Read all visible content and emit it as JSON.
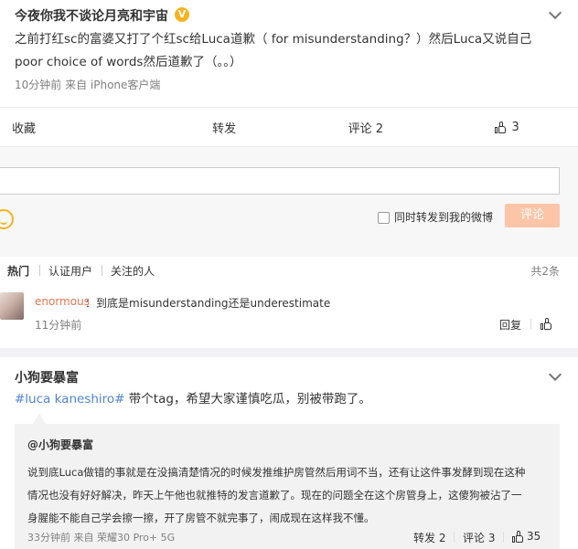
{
  "post1": {
    "author": "今夜你我不谈论月亮和宇宙",
    "verified_badge": "V",
    "line1": "之前打红sc的富婆又打了个红sc给Luca道歉（ for misunderstanding？）然后Luca又说自己",
    "line2": "poor choice of words然后道歉了（。。）",
    "meta": "10分钟前  来自 iPhone客户端"
  },
  "actions": {
    "favorite": "收藏",
    "repost": "转发",
    "comment": "评论 2",
    "like_count": "3"
  },
  "comment_box": {
    "also_repost_label": "同时转发到我的微博",
    "submit_label": "评论"
  },
  "comment_tabs": {
    "hot": "热门",
    "verified": "认证用户",
    "following": "关注的人",
    "total": "共2条"
  },
  "comments": [
    {
      "user": "enormous",
      "text": "：到底是misunderstanding还是underestimate",
      "time": "11分钟前",
      "reply": "回复"
    }
  ],
  "post2": {
    "author": "小狗要暴富",
    "hashtag": "#luca kaneshiro#",
    "text": " 带个tag，希望大家谨慎吃瓜，别被带跑了。",
    "repost": {
      "author": "@小狗要暴富",
      "line1": "说到底Luca做错的事就是在没搞清楚情况的时候发推维护房管然后用词不当，还有让这件事发酵到现在这种",
      "line2": "情况也没有好好解决，昨天上午他也就推特的发言道歉了。现在的问题全在这个房管身上，这傻狗被沾了一",
      "line3": "身腥能不能自己学会擦一擦，开了房管不就完事了，闹成现在这样我不懂。",
      "meta": "33分钟前  来自 荣耀30 Pro+ 5G",
      "repost_count": "转发 2",
      "comment_count": "评论 3",
      "like_count": "35"
    }
  }
}
